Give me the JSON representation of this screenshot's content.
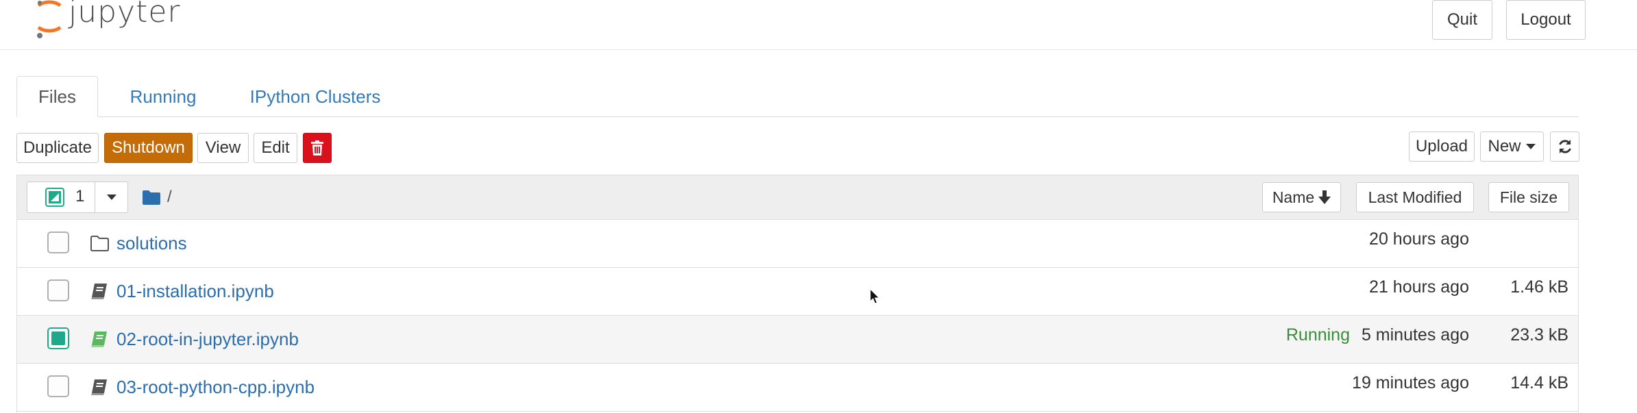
{
  "header": {
    "logo_text": "jupyter",
    "quit_label": "Quit",
    "logout_label": "Logout"
  },
  "tabs": [
    {
      "label": "Files",
      "active": true
    },
    {
      "label": "Running",
      "active": false
    },
    {
      "label": "IPython Clusters",
      "active": false
    }
  ],
  "toolbar": {
    "duplicate_label": "Duplicate",
    "shutdown_label": "Shutdown",
    "view_label": "View",
    "edit_label": "Edit",
    "delete_icon": "trash-icon",
    "upload_label": "Upload",
    "new_label": "New",
    "refresh_icon": "refresh-icon"
  },
  "list_header": {
    "selected_count": "1",
    "breadcrumb_path": "/",
    "sort_name_label": "Name",
    "last_modified_label": "Last Modified",
    "file_size_label": "File size"
  },
  "files": [
    {
      "name": "solutions",
      "type": "folder",
      "running": "",
      "modified": "20 hours ago",
      "size": "",
      "checked": false
    },
    {
      "name": "01-installation.ipynb",
      "type": "notebook",
      "running": "",
      "modified": "21 hours ago",
      "size": "1.46 kB",
      "checked": false
    },
    {
      "name": "02-root-in-jupyter.ipynb",
      "type": "notebook-running",
      "running": "Running",
      "modified": "5 minutes ago",
      "size": "23.3 kB",
      "checked": true
    },
    {
      "name": "03-root-python-cpp.ipynb",
      "type": "notebook",
      "running": "",
      "modified": "19 minutes ago",
      "size": "14.4 kB",
      "checked": false
    }
  ],
  "colors": {
    "link": "#2a6ead",
    "shutdown": "#c36c08",
    "delete": "#d9111d",
    "running": "#3c8b3c",
    "checkbox_checked": "#1fa98a",
    "logo_orange": "#f37726"
  }
}
